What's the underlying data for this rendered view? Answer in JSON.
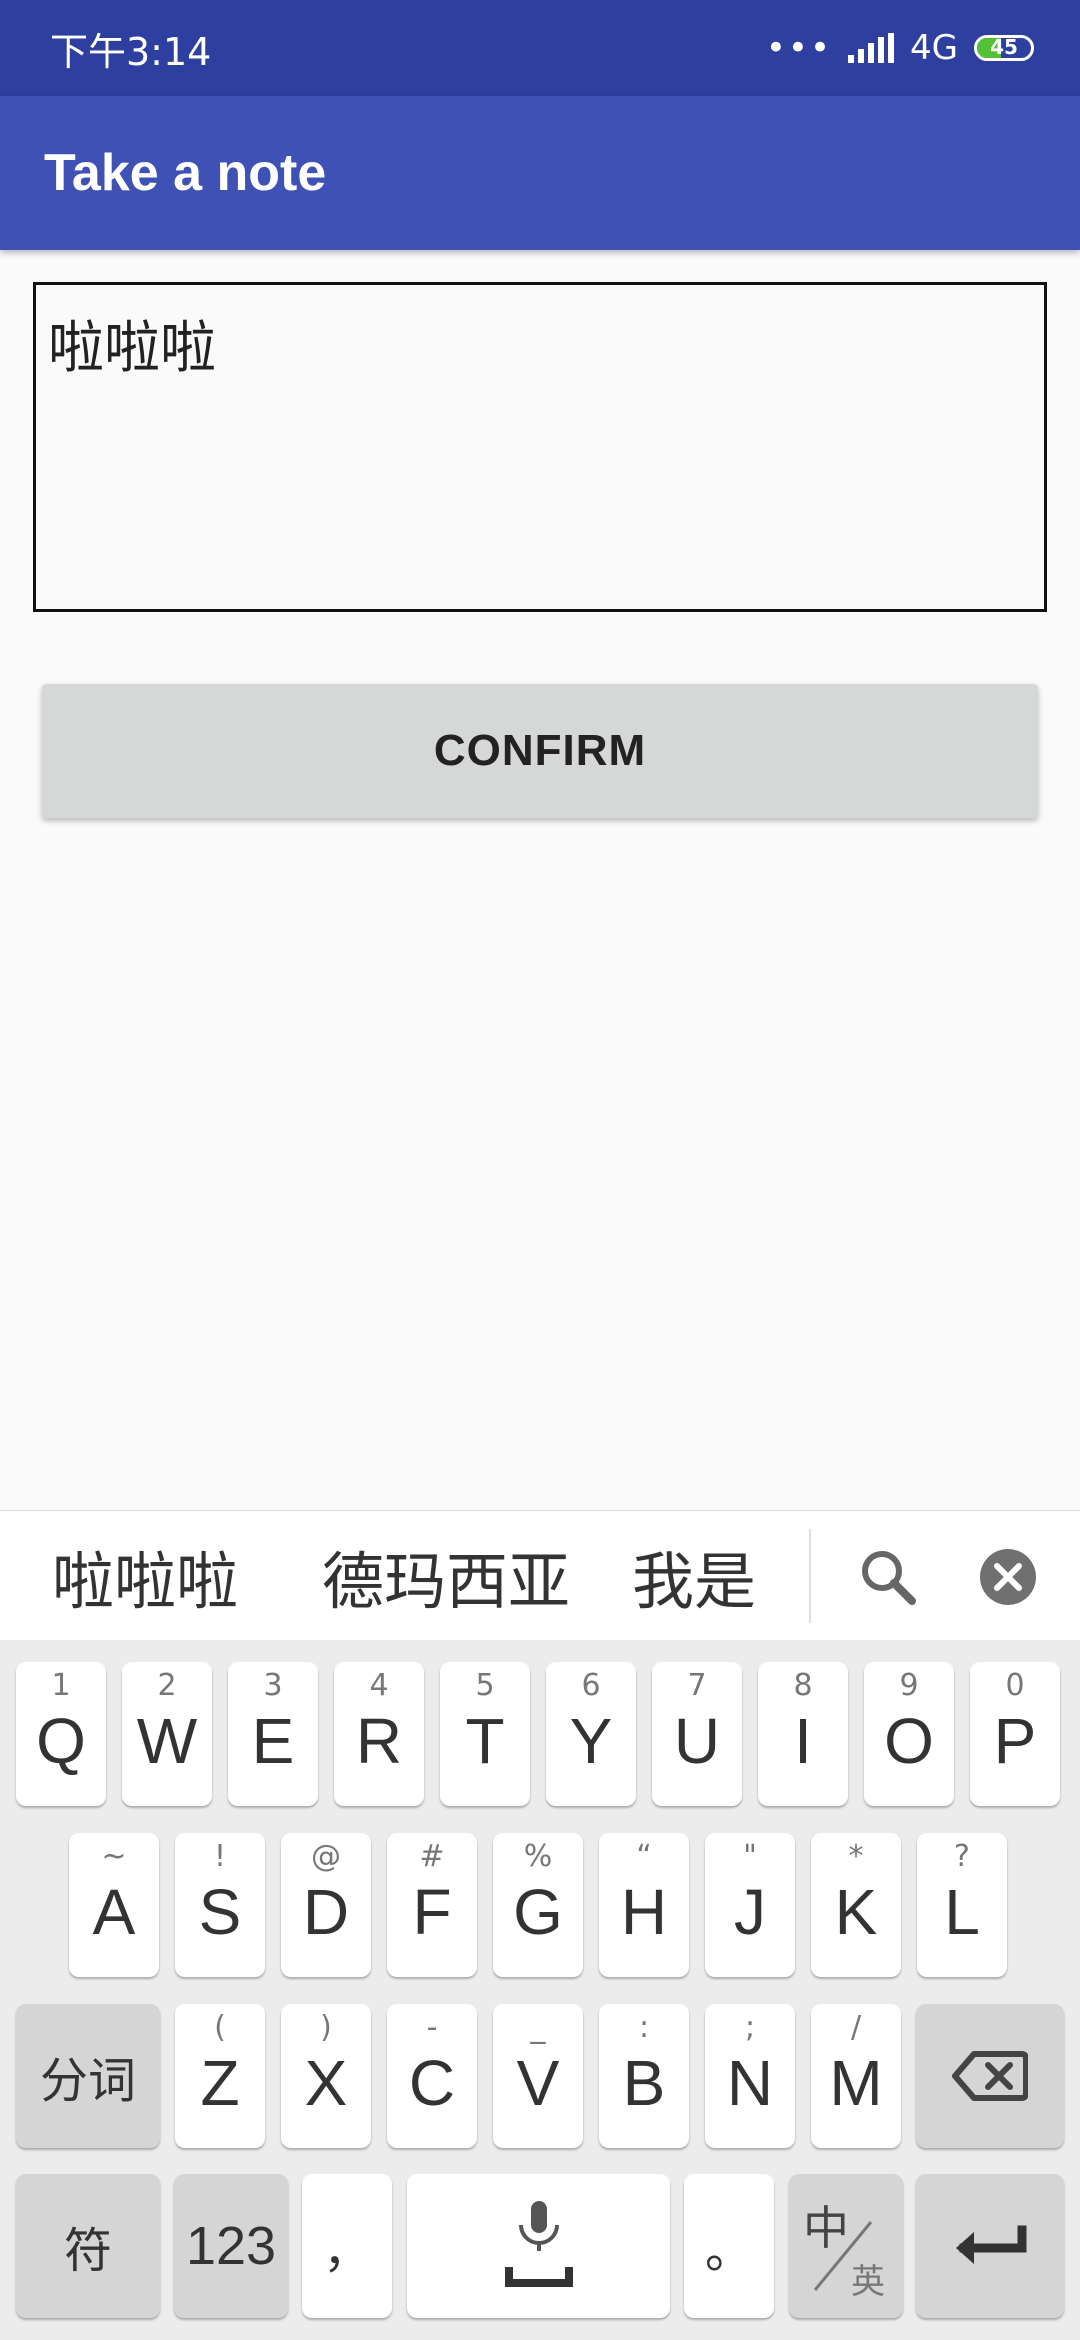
{
  "status_bar": {
    "time": "下午3:14",
    "dots": "•••",
    "network": "4G",
    "battery": "45",
    "battery_level": 0.45
  },
  "app_bar": {
    "title": "Take a note"
  },
  "note": {
    "value": "啦啦啦"
  },
  "confirm_label": "CONFIRM",
  "candidates": [
    "啦啦啦",
    "德玛西亚",
    "我是"
  ],
  "keyboard": {
    "row1": [
      {
        "k": "Q",
        "s": "1"
      },
      {
        "k": "W",
        "s": "2"
      },
      {
        "k": "E",
        "s": "3"
      },
      {
        "k": "R",
        "s": "4"
      },
      {
        "k": "T",
        "s": "5"
      },
      {
        "k": "Y",
        "s": "6"
      },
      {
        "k": "U",
        "s": "7"
      },
      {
        "k": "I",
        "s": "8"
      },
      {
        "k": "O",
        "s": "9"
      },
      {
        "k": "P",
        "s": "0"
      }
    ],
    "row2": [
      {
        "k": "A",
        "s": "~"
      },
      {
        "k": "S",
        "s": "!"
      },
      {
        "k": "D",
        "s": "@"
      },
      {
        "k": "F",
        "s": "#"
      },
      {
        "k": "G",
        "s": "%"
      },
      {
        "k": "H",
        "s": "“"
      },
      {
        "k": "J",
        "s": "\""
      },
      {
        "k": "K",
        "s": "*"
      },
      {
        "k": "L",
        "s": "?"
      }
    ],
    "row3": [
      {
        "k": "Z",
        "s": "("
      },
      {
        "k": "X",
        "s": ")"
      },
      {
        "k": "C",
        "s": "-"
      },
      {
        "k": "V",
        "s": "_"
      },
      {
        "k": "B",
        "s": ":"
      },
      {
        "k": "N",
        "s": ";"
      },
      {
        "k": "M",
        "s": "/"
      }
    ],
    "split_label": "分词",
    "symbol_label": "符",
    "num_label": "123",
    "comma_label": "，",
    "period_label": "。",
    "lang_main": "中",
    "lang_sub": "英"
  },
  "colors": {
    "status_bar": "#2f3fa0",
    "app_bar": "#3f51b5",
    "battery_fill": "#52c234"
  }
}
